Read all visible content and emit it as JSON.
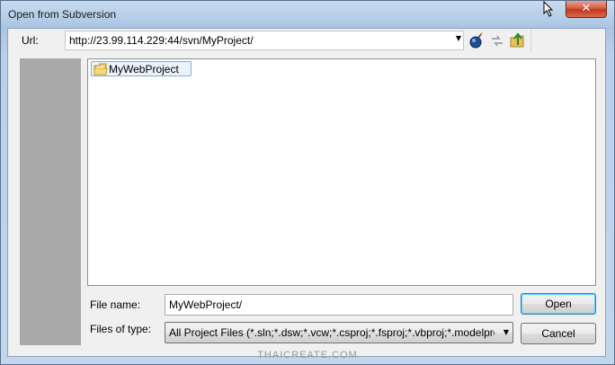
{
  "window": {
    "title": "Open from Subversion",
    "close_glyph": "✕"
  },
  "url": {
    "label": "Url:",
    "value": "http://23.99.114.229:44/svn/MyProject/",
    "dropdown_glyph": "▼"
  },
  "toolbar": {
    "icons": [
      "connect-icon",
      "refresh-icon",
      "up-folder-icon"
    ]
  },
  "browser": {
    "items": [
      {
        "label": "MyWebProject",
        "icon": "folder-icon",
        "selected": true
      }
    ]
  },
  "file_name": {
    "label": "File name:",
    "value": "MyWebProject/"
  },
  "file_type": {
    "label": "Files of type:",
    "value": "All Project Files (*.sln;*.dsw;*.vcw;*.csproj;*.fsproj;*.vbproj;*.modelproj",
    "dropdown_glyph": "▼"
  },
  "buttons": {
    "open": "Open",
    "cancel": "Cancel"
  },
  "watermark": "THAICREATE.COM",
  "colors": {
    "title_bar": "#b9d0ea",
    "close_button": "#c2381c",
    "places_pane": "#a9a9a9",
    "selection": "#eaf3fd",
    "selection_border": "#84acdd"
  }
}
